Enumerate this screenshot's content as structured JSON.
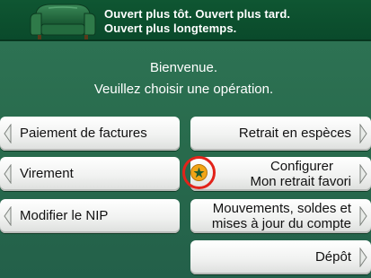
{
  "banner": {
    "line1": "Ouvert plus tôt.  Ouvert plus tard.",
    "line2": "Ouvert plus longtemps.",
    "logo_icon": "armchair-icon"
  },
  "welcome": {
    "line1": "Bienvenue.",
    "line2": "Veuillez choisir une opération."
  },
  "buttons": {
    "bill_payment": "Paiement de factures",
    "transfer": "Virement",
    "change_pin": "Modifier le NIP",
    "cash_withdrawal": "Retrait en espèces",
    "configure_line1": "Configurer",
    "configure_line2": "Mon retrait favori",
    "activity_line1": "Mouvements, soldes et",
    "activity_line2": "mises à jour du compte",
    "deposit": "Dépôt"
  },
  "colors": {
    "background": "#2a6b4e",
    "banner": "#0f5632",
    "highlight": "#e2231a",
    "star": "#f2a516"
  },
  "icons": {
    "favorite": "star-icon"
  }
}
